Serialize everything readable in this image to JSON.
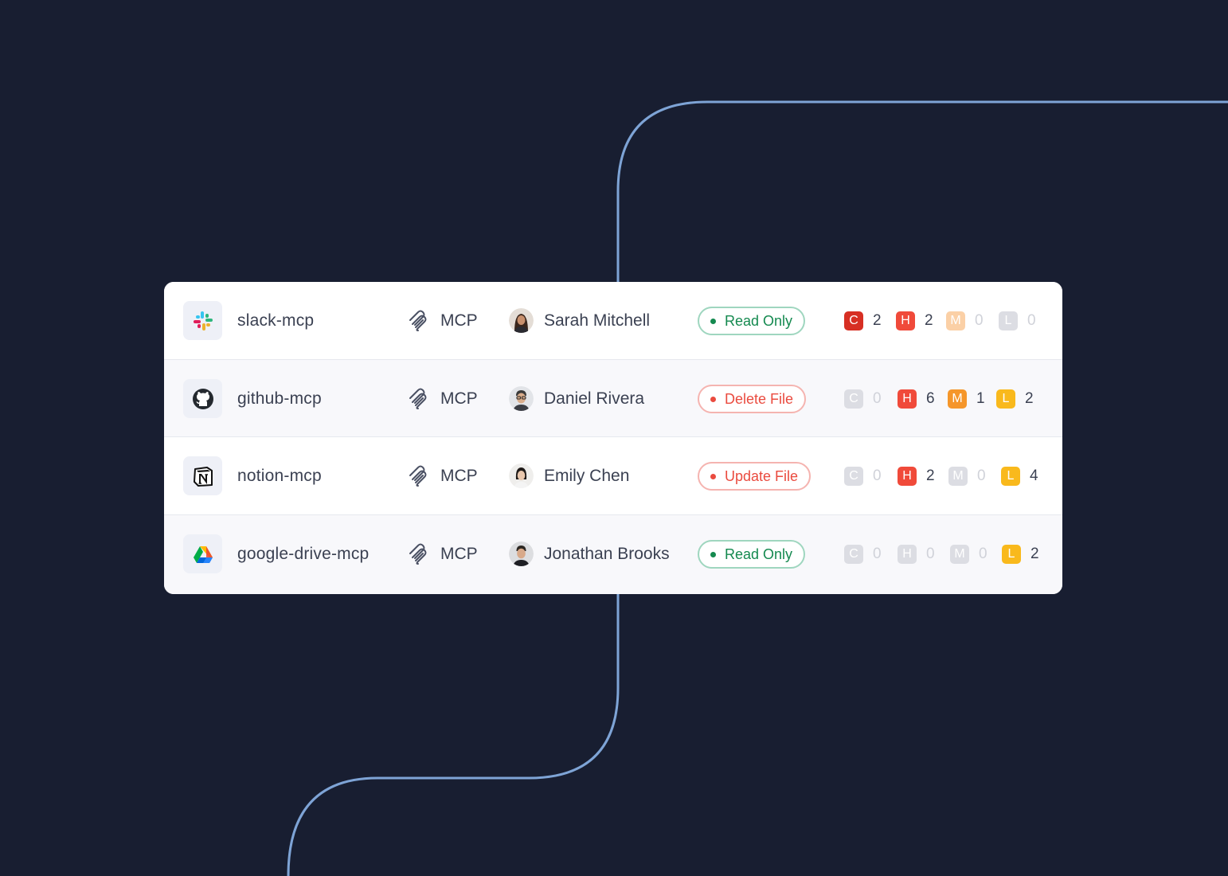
{
  "colors": {
    "background": "#181e31",
    "line": "#7ea4d6",
    "critical": "#d72f23",
    "high": "#f04a3a",
    "medium": "#f5962a",
    "low": "#f9b91c",
    "green": "#14894f",
    "red": "#ea4b3f"
  },
  "rows": [
    {
      "icon": "slack-icon",
      "name": "slack-mcp",
      "type_icon": "mcp-icon",
      "type": "MCP",
      "user": "Sarah Mitchell",
      "permission": "Read Only",
      "permission_status": "green",
      "severity": {
        "C": "2",
        "H": "2",
        "M": "0",
        "L": "0"
      }
    },
    {
      "icon": "github-icon",
      "name": "github-mcp",
      "type_icon": "mcp-icon",
      "type": "MCP",
      "user": "Daniel Rivera",
      "permission": "Delete File",
      "permission_status": "red",
      "severity": {
        "C": "0",
        "H": "6",
        "M": "1",
        "L": "2"
      }
    },
    {
      "icon": "notion-icon",
      "name": "notion-mcp",
      "type_icon": "mcp-icon",
      "type": "MCP",
      "user": "Emily Chen",
      "permission": "Update File",
      "permission_status": "red",
      "severity": {
        "C": "0",
        "H": "2",
        "M": "0",
        "L": "4"
      }
    },
    {
      "icon": "google-drive-icon",
      "name": "google-drive-mcp",
      "type_icon": "mcp-icon",
      "type": "MCP",
      "user": "Jonathan Brooks",
      "permission": "Read Only",
      "permission_status": "green",
      "severity": {
        "C": "0",
        "H": "0",
        "M": "0",
        "L": "2"
      }
    }
  ],
  "severity_labels": {
    "critical": "C",
    "high": "H",
    "medium": "M",
    "low": "L"
  }
}
